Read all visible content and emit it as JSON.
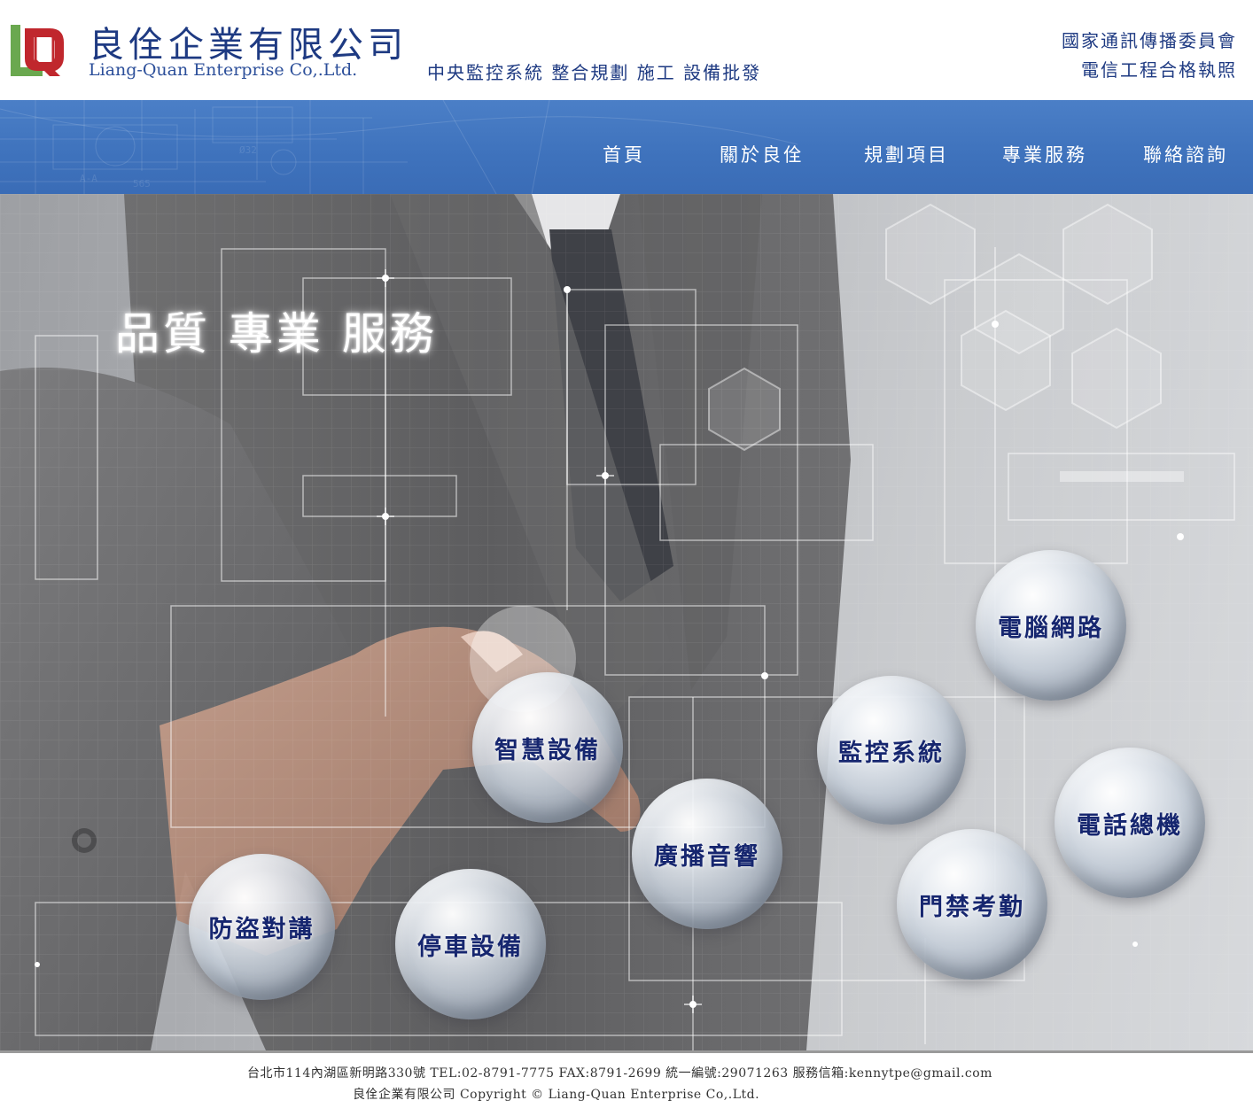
{
  "header": {
    "company_name_cn": "良佺企業有限公司",
    "company_name_en": "Liang-Quan Enterprise Co,.Ltd.",
    "tagline": "中央監控系統 整合規劃 施工 設備批發",
    "license_line1": "國家通訊傳播委員會",
    "license_line2": "電信工程合格執照",
    "logo_colors": {
      "green": "#6aa84f",
      "red": "#c0272d"
    }
  },
  "nav": {
    "items": [
      {
        "label": "首頁"
      },
      {
        "label": "關於良佺"
      },
      {
        "label": "規劃項目"
      },
      {
        "label": "專業服務"
      },
      {
        "label": "聯絡諮詢"
      }
    ]
  },
  "hero": {
    "title": "品質  專業  服務",
    "services": [
      {
        "label": "電腦網路"
      },
      {
        "label": "智慧設備"
      },
      {
        "label": "監控系統"
      },
      {
        "label": "廣播音響"
      },
      {
        "label": "電話總機"
      },
      {
        "label": "門禁考勤"
      },
      {
        "label": "防盜對講"
      },
      {
        "label": "停車設備"
      }
    ]
  },
  "footer": {
    "address": "台北市114內湖區新明路330號  TEL:02-8791-7775  FAX:8791-2699  統一編號:29071263  服務信箱:kennytpe@gmail.com",
    "copyright": "良佺企業有限公司 Copyright © Liang-Quan Enterprise Co,.Ltd."
  },
  "colors": {
    "brand_blue": "#1e3a82",
    "nav_blue": "#3f73bd",
    "ball_text": "#16266f"
  }
}
